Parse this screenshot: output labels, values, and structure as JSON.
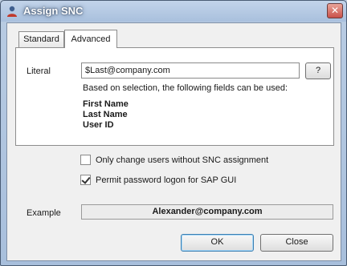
{
  "window": {
    "title": "Assign SNC",
    "close_glyph": "✕"
  },
  "tabs": [
    {
      "label": "Standard",
      "active": false
    },
    {
      "label": "Advanced",
      "active": true
    }
  ],
  "literal": {
    "label": "Literal",
    "value": "$Last@company.com",
    "help_label": "?"
  },
  "hint": "Based on selection, the following fields can be used:",
  "fields": [
    "First Name",
    "Last Name",
    "User ID"
  ],
  "options": [
    {
      "label": "Only change users without SNC assignment",
      "checked": false
    },
    {
      "label": "Permit password logon for SAP GUI",
      "checked": true
    }
  ],
  "example": {
    "label": "Example",
    "value": "Alexander@company.com"
  },
  "buttons": {
    "ok": "OK",
    "close": "Close"
  },
  "colors": {
    "accent": "#3c7fb1",
    "close_button": "#c9514a"
  }
}
